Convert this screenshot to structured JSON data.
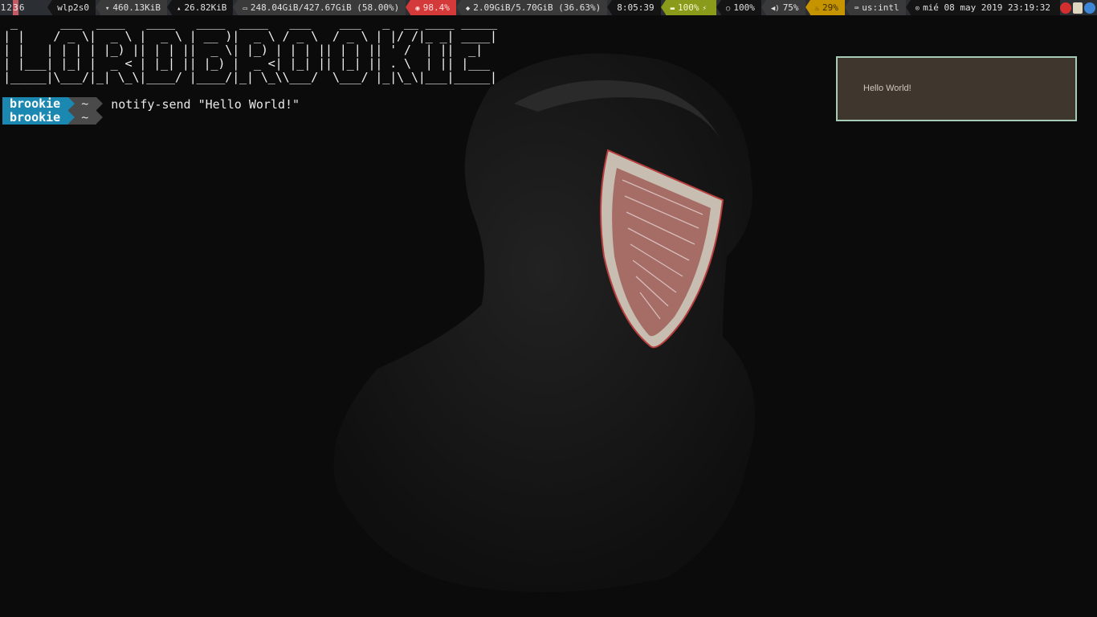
{
  "workspaces": [
    {
      "label": "1",
      "active": false
    },
    {
      "label": "2",
      "active": false
    },
    {
      "label": "3",
      "active": true
    },
    {
      "label": "6",
      "active": false
    }
  ],
  "statusbar": {
    "interface": "wlp2s0",
    "download": "460.13KiB",
    "upload": "26.82KiB",
    "disk": "248.04GiB/427.67GiB (58.00%)",
    "cpu": "98.4%",
    "memory": "2.09GiB/5.70GiB (36.63%)",
    "uptime": "8:05:39",
    "battery": "100%",
    "brightness": "100%",
    "volume": "75%",
    "temperature": "29%",
    "keyboard": "us:intl",
    "datetime": "mié 08 may 2019 23:19:32",
    "colors": {
      "bar": "#2b2e33",
      "dark_segment": "#141414",
      "mid_segment": "#3a3a3a",
      "cpu_alert": "#d53a3a",
      "battery_ok": "#8a9a1a",
      "temperature_warn": "#c59400",
      "active_workspace": "#c45b64"
    }
  },
  "tray": {
    "icons": [
      "mail-icon",
      "clipboard-icon",
      "user-icon"
    ]
  },
  "terminal": {
    "ascii_art": [
      " _      ___  ____   ____   ____  ____   ___    ___   _  __ ____ _____",
      "| |    / _ \\|  _ \\ |  _ \\ | __ )|  _ \\ / _ \\  / _ \\ | |/ /|_ _| ____|",
      "| |   | | | | |_) || | | ||  _ \\| |_) | | | || | | || ' /  | ||  _|",
      "| |___| |_| |  _ < | |_| || |_) |  _ <| |_| || |_| || . \\  | || |___",
      "|_____|\\___/|_| \\_\\|____/ |____/|_| \\_\\\\___/  \\___/ |_|\\_\\|___|_____|"
    ],
    "prompts": [
      {
        "user": "brookie",
        "dir": "~",
        "command": "notify-send \"Hello World!\""
      },
      {
        "user": "brookie",
        "dir": "~",
        "command": ""
      }
    ]
  },
  "notification": {
    "body": "Hello World!"
  }
}
